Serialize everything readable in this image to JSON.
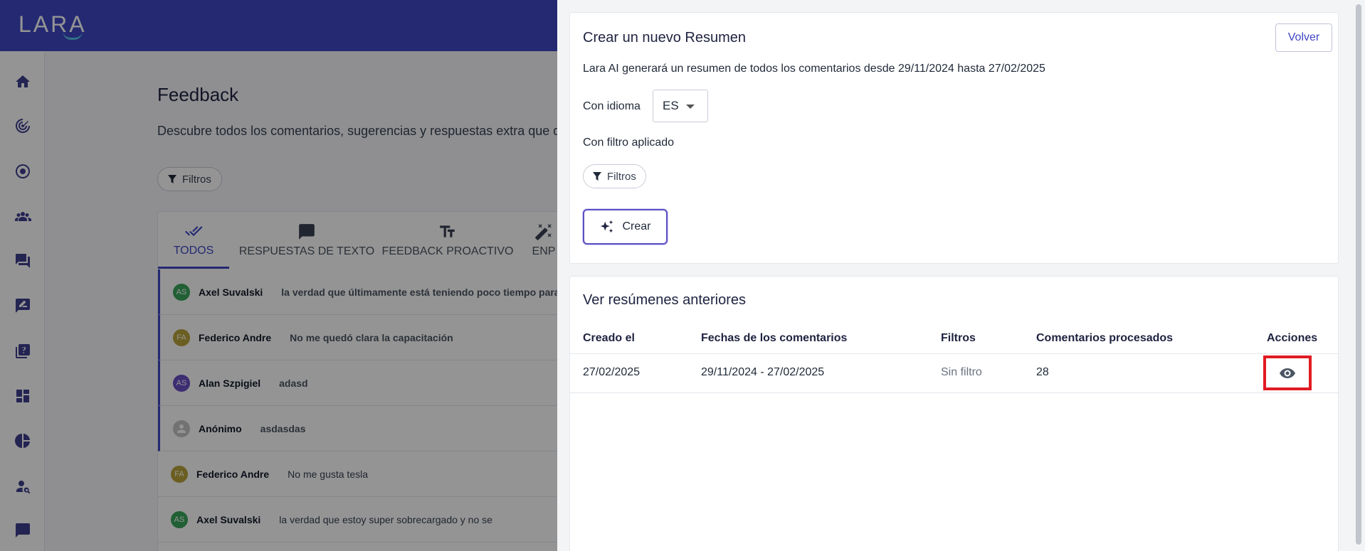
{
  "app": {
    "logo": "LARA"
  },
  "sidebar": {
    "items": [
      {
        "icon": "home-icon"
      },
      {
        "icon": "radar-icon"
      },
      {
        "icon": "target-icon"
      },
      {
        "icon": "team-icon"
      },
      {
        "icon": "chat-icon"
      },
      {
        "icon": "feedback-icon"
      },
      {
        "icon": "help-book-icon"
      },
      {
        "icon": "dashboard-icon"
      },
      {
        "icon": "pie-chart-icon"
      },
      {
        "icon": "user-search-icon"
      },
      {
        "icon": "message-icon"
      }
    ]
  },
  "background": {
    "title": "Feedback",
    "description": "Descubre todos los comentarios, sugerencias y respuestas extra que de",
    "filter_label": "Filtros",
    "tabs": [
      {
        "label": "TODOS",
        "icon": "double-check-icon"
      },
      {
        "label": "RESPUESTAS DE TEXTO",
        "icon": "comment-icon"
      },
      {
        "label": "FEEDBACK PROACTIVO",
        "icon": "text-size-icon"
      },
      {
        "label": "ENP",
        "icon": "sparkle-icon"
      }
    ],
    "feedback": [
      {
        "initials": "AS",
        "name": "Axel Suvalski",
        "text": "la verdad que últimamente está teniendo poco tiempo para mi",
        "color": "#3aa55a",
        "bold": true
      },
      {
        "initials": "FA",
        "name": "Federico Andre",
        "text": "No me quedó clara la capacitación",
        "color": "#b8a23a",
        "bold": true
      },
      {
        "initials": "AS",
        "name": "Alan Szpigiel",
        "text": "adasd",
        "color": "#6a4fc4",
        "bold": true
      },
      {
        "initials": "",
        "name": "Anónimo",
        "text": "asdasdas",
        "color": "#c4c4c4",
        "bold": true
      },
      {
        "initials": "FA",
        "name": "Federico Andre",
        "text": "No me gusta tesla",
        "color": "#b8a23a",
        "bold": false
      },
      {
        "initials": "AS",
        "name": "Axel Suvalski",
        "text": "la verdad que estoy super sobrecargado y no se",
        "color": "#3aa55a",
        "bold": false
      }
    ]
  },
  "drawer": {
    "create": {
      "title": "Crear un nuevo Resumen",
      "back_label": "Volver",
      "description": "Lara AI generará un resumen de todos los comentarios desde 29/11/2024 hasta 27/02/2025",
      "language_label": "Con idioma",
      "language_value": "ES",
      "filter_label": "Con filtro aplicado",
      "filter_chip": "Filtros",
      "create_label": "Crear"
    },
    "history": {
      "title": "Ver resúmenes anteriores",
      "columns": [
        "Creado el",
        "Fechas de los comentarios",
        "Filtros",
        "Comentarios procesados",
        "Acciones"
      ],
      "rows": [
        {
          "created": "27/02/2025",
          "dates": "29/11/2024 - 27/02/2025",
          "filters": "Sin filtro",
          "processed": "28",
          "action_icon": "eye-icon"
        }
      ]
    }
  },
  "colors": {
    "brand": "#3f47c4",
    "highlight": "#e01b22"
  }
}
